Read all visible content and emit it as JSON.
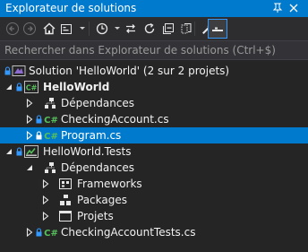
{
  "window": {
    "title": "Explorateur de solutions"
  },
  "search": {
    "placeholder": "Rechercher dans Explorateur de solutions (Ctrl+$)"
  },
  "tree": {
    "solution": "Solution 'HelloWorld' (2 sur 2 projets)",
    "project1": "HelloWorld",
    "project1_deps": "Dépendances",
    "file_checking": "CheckingAccount.cs",
    "file_program": "Program.cs",
    "project2": "HelloWorld.Tests",
    "project2_deps": "Dépendances",
    "frameworks": "Frameworks",
    "packages": "Packages",
    "projets": "Projets",
    "file_tests": "CheckingAccountTests.cs"
  },
  "icons": {
    "csharp_badge": "C#",
    "accent": "#007acc",
    "selection": "#007acc",
    "lock": "#3399ff",
    "csharp_color": "#56c05a"
  }
}
